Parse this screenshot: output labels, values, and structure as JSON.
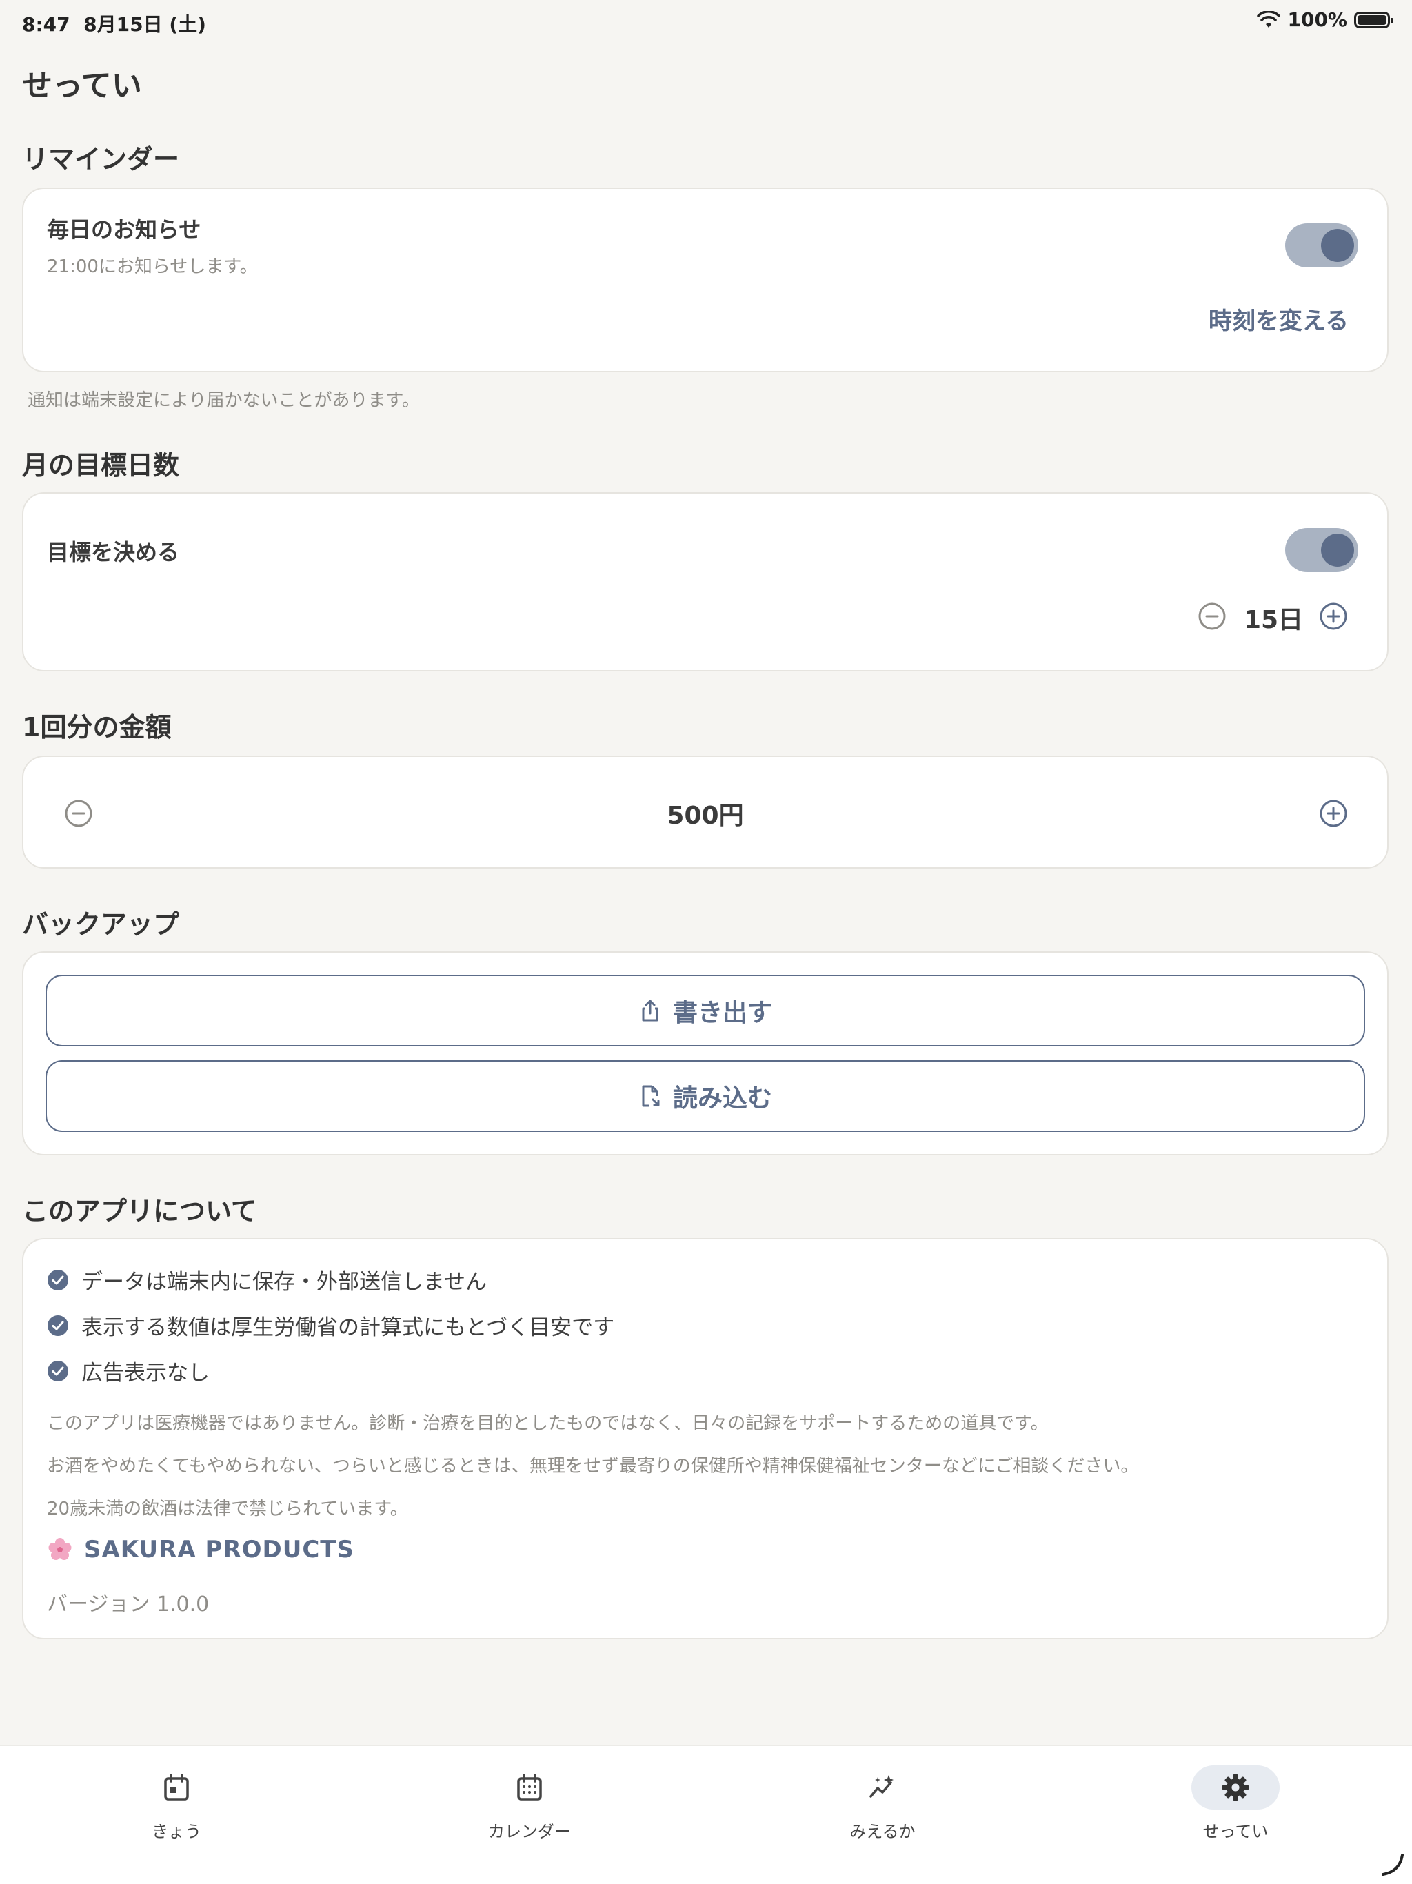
{
  "status": {
    "time": "8:47",
    "date": "8月15日 (土)",
    "battery": "100%"
  },
  "page": {
    "title": "せってい"
  },
  "reminder": {
    "section_title": "リマインダー",
    "daily_title": "毎日のお知らせ",
    "daily_sub": "21:00にお知らせします。",
    "toggle_on": true,
    "change_time": "時刻を変える",
    "note": "通知は端末設定により届かないことがあります。"
  },
  "goal": {
    "section_title": "月の目標日数",
    "set_goal": "目標を決める",
    "toggle_on": true,
    "value": "15日"
  },
  "amount": {
    "section_title": "1回分の金額",
    "value": "500円"
  },
  "backup": {
    "section_title": "バックアップ",
    "export_label": "書き出す",
    "import_label": "読み込む"
  },
  "about": {
    "section_title": "このアプリについて",
    "checks": [
      "データは端末内に保存・外部送信しません",
      "表示する数値は厚生労働省の計算式にもとづく目安です",
      "広告表示なし"
    ],
    "notes": [
      "このアプリは医療機器ではありません。診断・治療を目的としたものではなく、日々の記録をサポートするための道具です。",
      "お酒をやめたくてもやめられない、つらいと感じるときは、無理をせず最寄りの保健所や精神保健福祉センターなどにご相談ください。",
      "20歳未満の飲酒は法律で禁じられています。"
    ],
    "brand": "SAKURA PRODUCTS",
    "brand_icon": "cherry-blossom-icon",
    "version": "バージョン 1.0.0"
  },
  "tabs": [
    {
      "label": "きょう",
      "icon": "calendar-day-icon"
    },
    {
      "label": "カレンダー",
      "icon": "calendar-icon"
    },
    {
      "label": "みえるか",
      "icon": "sparkle-chart-icon"
    },
    {
      "label": "せってい",
      "icon": "gear-icon",
      "active": true
    }
  ],
  "colors": {
    "accent": "#5c6c89",
    "background": "#f6f5f2",
    "toggle_track": "#a9b3c2",
    "muted_text": "#8f8d88"
  }
}
